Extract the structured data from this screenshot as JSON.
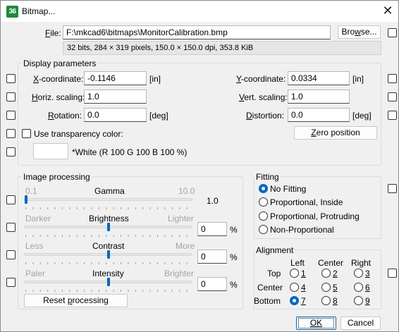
{
  "window": {
    "title": "Bitmap...",
    "app_icon": "36"
  },
  "file": {
    "label": "File:",
    "path": "F:\\mkcad6\\bitmaps\\MonitorCalibration.bmp",
    "info": "32 bits, 284 × 319 pixels, 150.0 × 150.0 dpi, 353.8 KiB",
    "browse_label": "Browse..."
  },
  "display": {
    "title": "Display parameters",
    "x_label": "X-coordinate:",
    "x_value": "-0.1146",
    "x_unit": "[in]",
    "y_label": "Y-coordinate:",
    "y_value": "0.0334",
    "y_unit": "[in]",
    "hscale_label": "Horiz. scaling:",
    "hscale_value": "1.0",
    "vscale_label": "Vert. scaling:",
    "vscale_value": "1.0",
    "rotation_label": "Rotation:",
    "rotation_value": "0.0",
    "rotation_unit": "[deg]",
    "distortion_label": "Distortion:",
    "distortion_value": "0.0",
    "distortion_unit": "[deg]",
    "transparency_label": "Use transparency color:",
    "zero_label": "Zero position",
    "color_text": "*White (R 100 G 100 B 100 %)",
    "color_hex": "#ffffff"
  },
  "processing": {
    "title": "Image processing",
    "gamma": {
      "name": "Gamma",
      "min": "0.1",
      "max": "10.0",
      "value": "1.0",
      "level": 0.0
    },
    "brightness": {
      "name": "Brightness",
      "min": "Darker",
      "max": "Lighter",
      "value": "0",
      "unit": "%",
      "level": 0.5
    },
    "contrast": {
      "name": "Contrast",
      "min": "Less",
      "max": "More",
      "value": "0",
      "unit": "%",
      "level": 0.5
    },
    "intensity": {
      "name": "Intensity",
      "min": "Paler",
      "max": "Brighter",
      "value": "0",
      "unit": "%",
      "level": 0.5
    },
    "reset_label": "Reset processing"
  },
  "fitting": {
    "title": "Fitting",
    "options": [
      "No Fitting",
      "Proportional, Inside",
      "Proportional, Protruding",
      "Non-Proportional"
    ],
    "selected": 0
  },
  "alignment": {
    "title": "Alignment",
    "cols": [
      "Left",
      "Center",
      "Right"
    ],
    "rows": [
      "Top",
      "Center",
      "Bottom"
    ],
    "numbers": [
      "1",
      "2",
      "3",
      "4",
      "5",
      "6",
      "7",
      "8",
      "9"
    ],
    "selected": "7"
  },
  "buttons": {
    "ok": "OK",
    "cancel": "Cancel"
  },
  "colors": {
    "accent": "#0067c0",
    "app_icon_bg": "#1f8a3a"
  }
}
